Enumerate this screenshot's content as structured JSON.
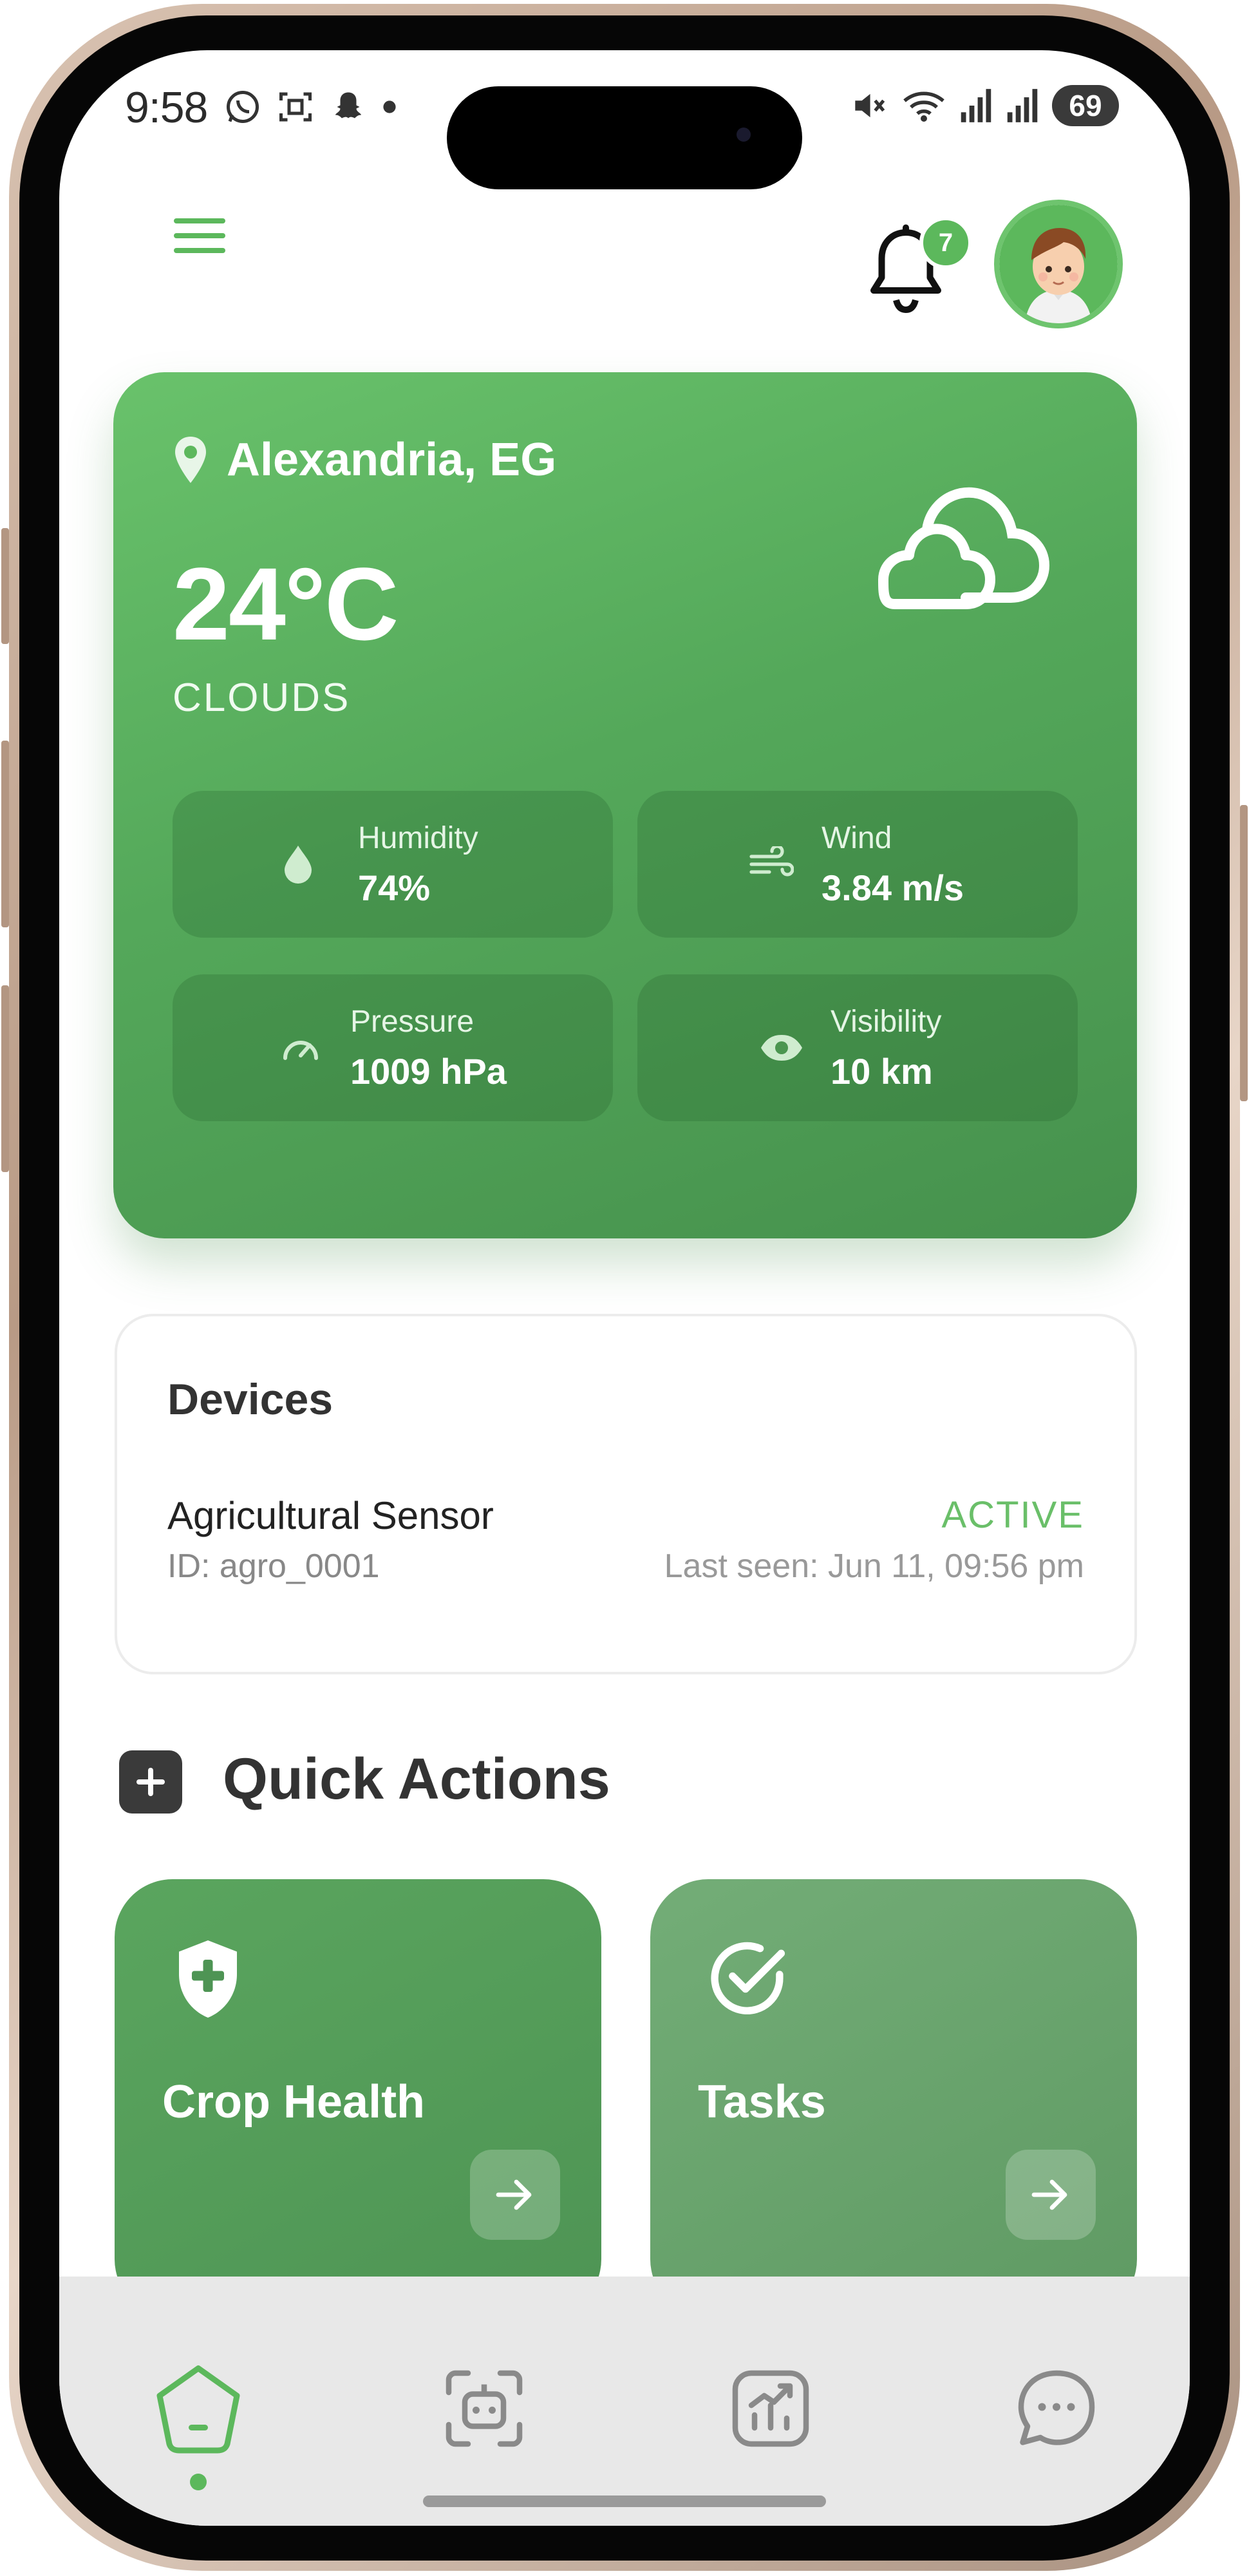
{
  "status_bar": {
    "time": "9:58",
    "battery": "69",
    "signal_label": "5"
  },
  "header": {
    "notification_count": "7"
  },
  "weather": {
    "location": "Alexandria, EG",
    "temperature": "24°C",
    "condition": "CLOUDS",
    "stats": [
      {
        "label": "Humidity",
        "value": "74%",
        "icon": "droplet-icon"
      },
      {
        "label": "Wind",
        "value": "3.84 m/s",
        "icon": "wind-icon"
      },
      {
        "label": "Pressure",
        "value": "1009 hPa",
        "icon": "gauge-icon"
      },
      {
        "label": "Visibility",
        "value": "10 km",
        "icon": "eye-icon"
      }
    ]
  },
  "devices": {
    "title": "Devices",
    "items": [
      {
        "name": "Agricultural Sensor",
        "id_text": "ID: agro_0001",
        "status": "ACTIVE",
        "last_seen": "Last seen: Jun 11, 09:56 pm"
      }
    ]
  },
  "quick_actions": {
    "title": "Quick Actions",
    "cards": [
      {
        "label": "Crop Health",
        "icon": "shield-plus-icon"
      },
      {
        "label": "Tasks",
        "icon": "check-circle-icon"
      }
    ]
  },
  "bottom_nav": {
    "items": [
      "home-icon",
      "scan-bot-icon",
      "chart-icon",
      "chat-icon"
    ],
    "active_index": 0
  },
  "colors": {
    "accent": "#5cb85c",
    "weather_card": "#54a85a",
    "status_active": "#6abf69"
  }
}
